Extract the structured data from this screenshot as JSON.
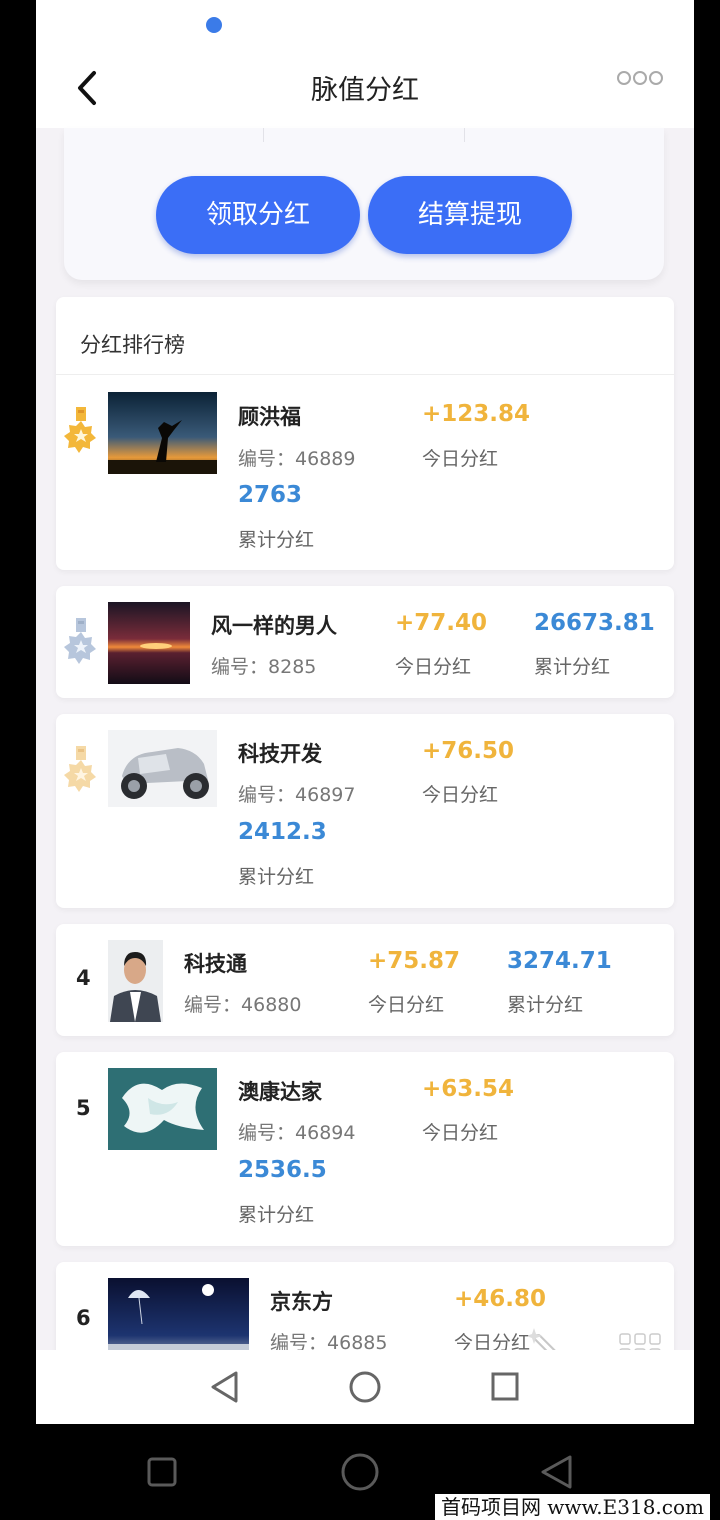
{
  "header": {
    "title": "脉值分红",
    "back_icon": "chevron-left-icon",
    "more_icon": "more-dots-icon"
  },
  "actions": {
    "claim_label": "领取分红",
    "withdraw_label": "结算提现"
  },
  "ranking": {
    "title": "分红排行榜",
    "id_prefix": "编号：",
    "today_label": "今日分红",
    "total_label": "累计分红",
    "entries": [
      {
        "rank": "1",
        "name": "顾洪福",
        "id": "46889",
        "today": "+123.84",
        "total": "2763"
      },
      {
        "rank": "2",
        "name": "风一样的男人",
        "id": "8285",
        "today": "+77.40",
        "total": "26673.81"
      },
      {
        "rank": "3",
        "name": "科技开发",
        "id": "46897",
        "today": "+76.50",
        "total": "2412.3"
      },
      {
        "rank": "4",
        "name": "科技通",
        "id": "46880",
        "today": "+75.87",
        "total": "3274.71"
      },
      {
        "rank": "5",
        "name": "澳康达家",
        "id": "46894",
        "today": "+63.54",
        "total": "2536.5"
      },
      {
        "rank": "6",
        "name": "京东方",
        "id": "46885",
        "today": "+46.80",
        "total": ""
      }
    ]
  },
  "colors": {
    "accent": "#3b6ef6",
    "today": "#f0b43c",
    "total": "#3b89d6",
    "gold": "#f3b73a",
    "silver": "#b7c6dc"
  },
  "watermark": "首码项目网 www.E318.com"
}
